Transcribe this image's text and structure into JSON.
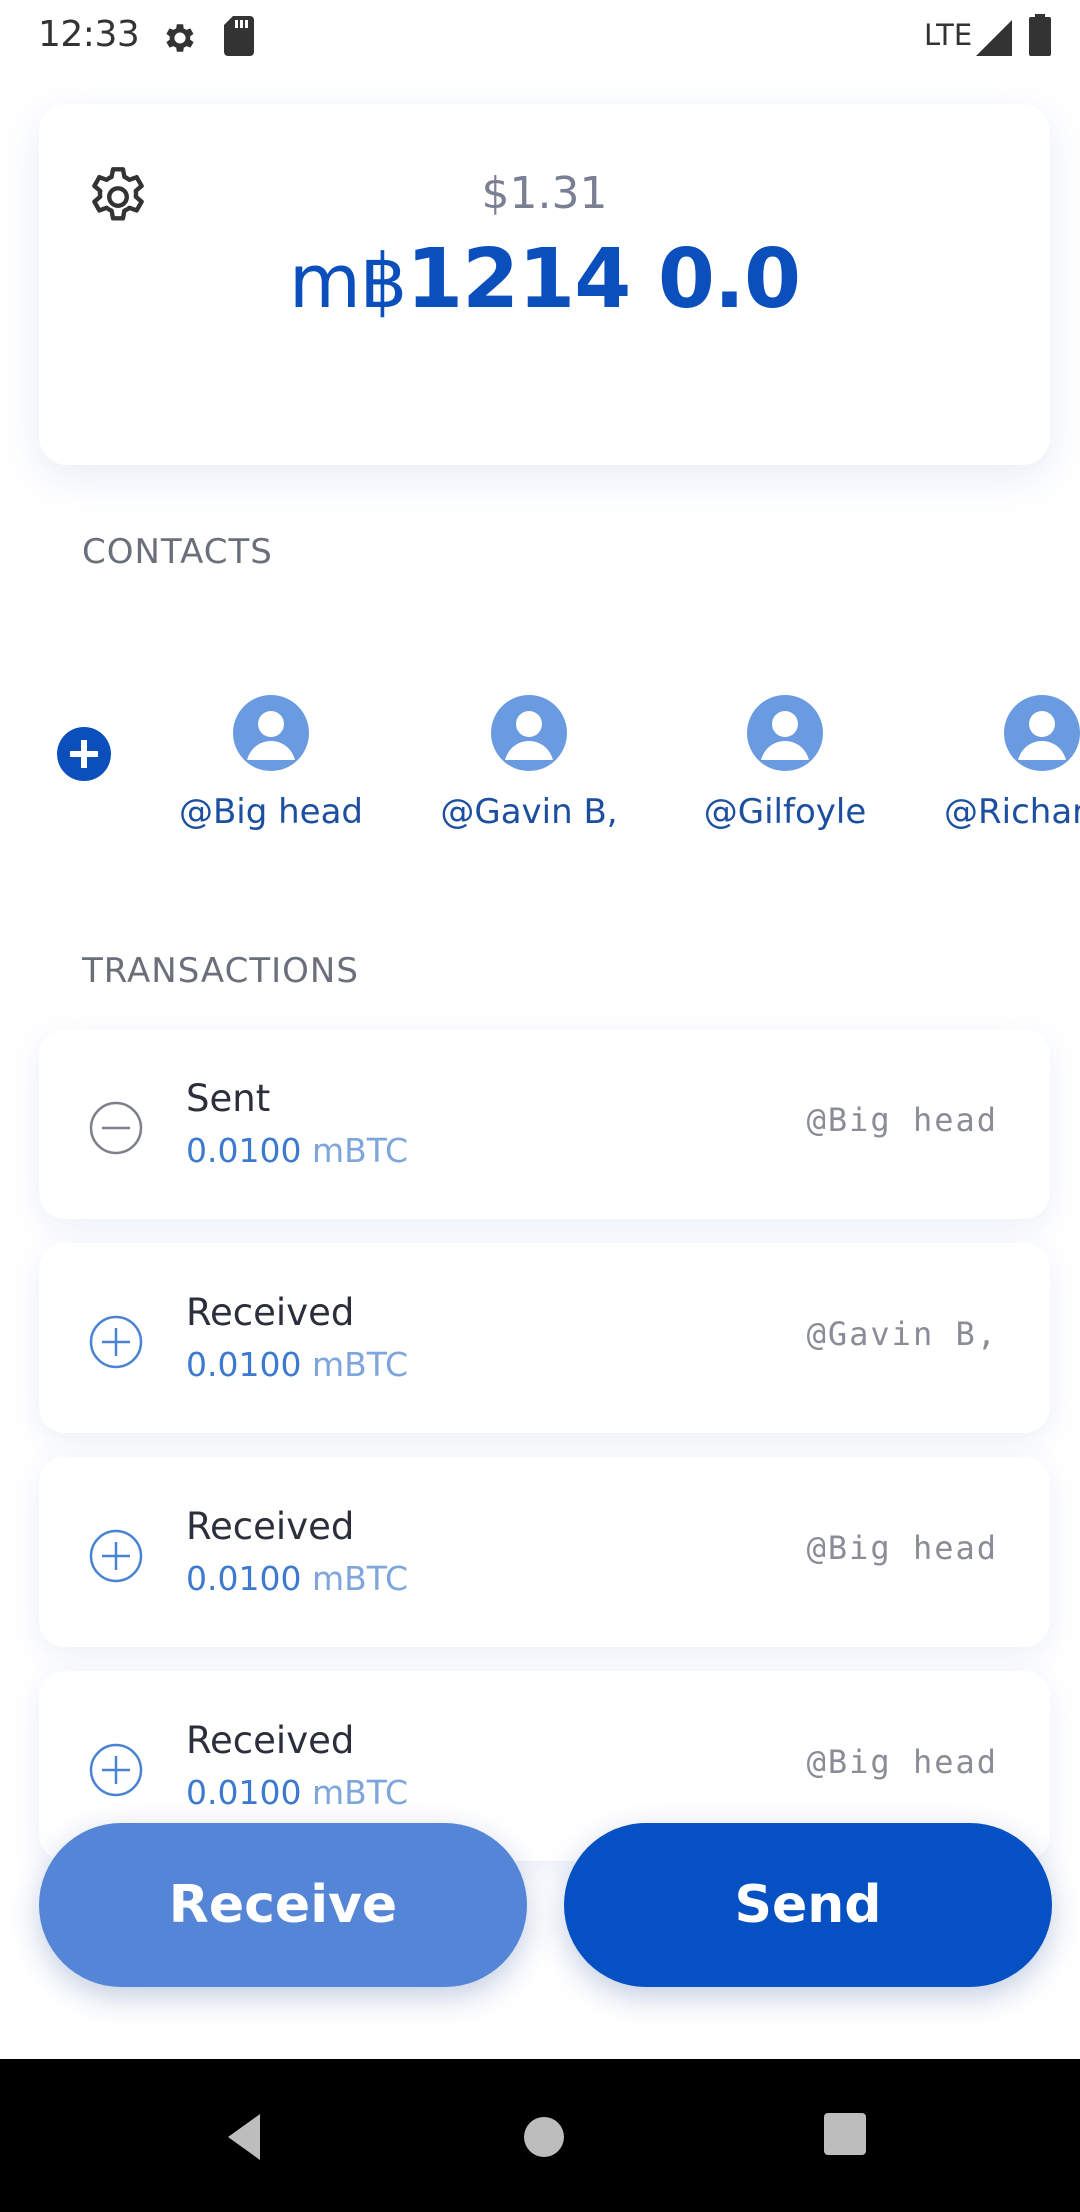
{
  "status_bar": {
    "time": "12:33",
    "network": "LTE"
  },
  "balance": {
    "fiat": "$1.31",
    "crypto_unit": "m฿",
    "crypto_value": "1214 0.0"
  },
  "contacts": {
    "header": "CONTACTS",
    "items": [
      {
        "name": "@Big head"
      },
      {
        "name": "@Gavin B,"
      },
      {
        "name": "@Gilfoyle"
      },
      {
        "name": "@Richard"
      }
    ]
  },
  "transactions": {
    "header": "TRANSACTIONS",
    "items": [
      {
        "type": "Sent",
        "direction": "out",
        "amount": "0.0100",
        "unit": "mBTC",
        "contact": "@Big head"
      },
      {
        "type": "Received",
        "direction": "in",
        "amount": "0.0100",
        "unit": "mBTC",
        "contact": "@Gavin B,"
      },
      {
        "type": "Received",
        "direction": "in",
        "amount": "0.0100",
        "unit": "mBTC",
        "contact": "@Big head"
      },
      {
        "type": "Received",
        "direction": "in",
        "amount": "0.0100",
        "unit": "mBTC",
        "contact": "@Big head"
      }
    ]
  },
  "actions": {
    "receive_label": "Receive",
    "send_label": "Send"
  },
  "colors": {
    "primary": "#0a4fbc",
    "receive_button": "#5585d6",
    "send_button": "#0550c2",
    "avatar": "#6a9be0"
  }
}
